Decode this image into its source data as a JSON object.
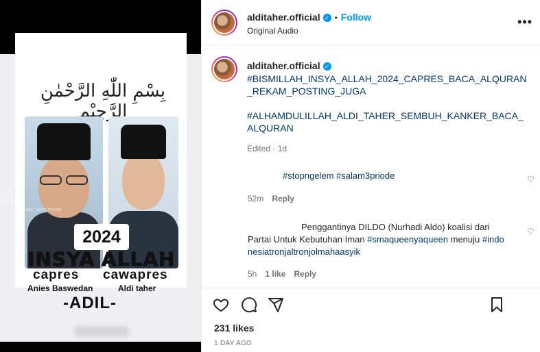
{
  "post": {
    "username": "alditaher.official",
    "follow_label": "Follow",
    "audio": "Original Audio",
    "more_icon": "more-horizontal-icon"
  },
  "media": {
    "bismillah": "بِسْمِ اللّٰهِ الرَّحْمٰنِ الرَّحِيْمِ",
    "year": "2024",
    "left_big": "INSYA",
    "right_big": "ALLAH",
    "left_role": "capres",
    "right_role": "cawapres",
    "left_name": "Anies Baswedan",
    "right_name": "Aldi taher",
    "slogan": "-ADIL-",
    "watermark_brand": "TikTok",
    "watermark_user": "@aldi_taher.official"
  },
  "caption": {
    "username": "alditaher.official",
    "tag1": "#BISMILLAH_INSYA_ALLAH_2024_CAPRES_BACA_ALQURAN_REKAM_POSTING_JUGA",
    "tag2": "#ALHAMDULILLAH_ALDI_TAHER_SEMBUH_KANKER_BACA_ALQURAN",
    "edited": "Edited · 1d"
  },
  "comments": [
    {
      "tags": "#stopngelem #salam3priode",
      "time": "52m",
      "reply": "Reply"
    },
    {
      "text_before": "Penggantinya DILDO (Nurhadi Aldo) koalisi dari Partai Untuk Kebutuhan Iman ",
      "tag_a": "#smaqueenyaqueen",
      "text_mid": " menuju ",
      "tag_b": "#indonesiatronjaltronjolmahaasyik",
      "time": "5h",
      "likes": "1 like",
      "reply": "Reply"
    }
  ],
  "footer": {
    "likes": "231 likes",
    "date": "1 DAY AGO"
  },
  "colors": {
    "accent": "#0095f6",
    "hashtag": "#00376b",
    "muted": "#737373"
  }
}
